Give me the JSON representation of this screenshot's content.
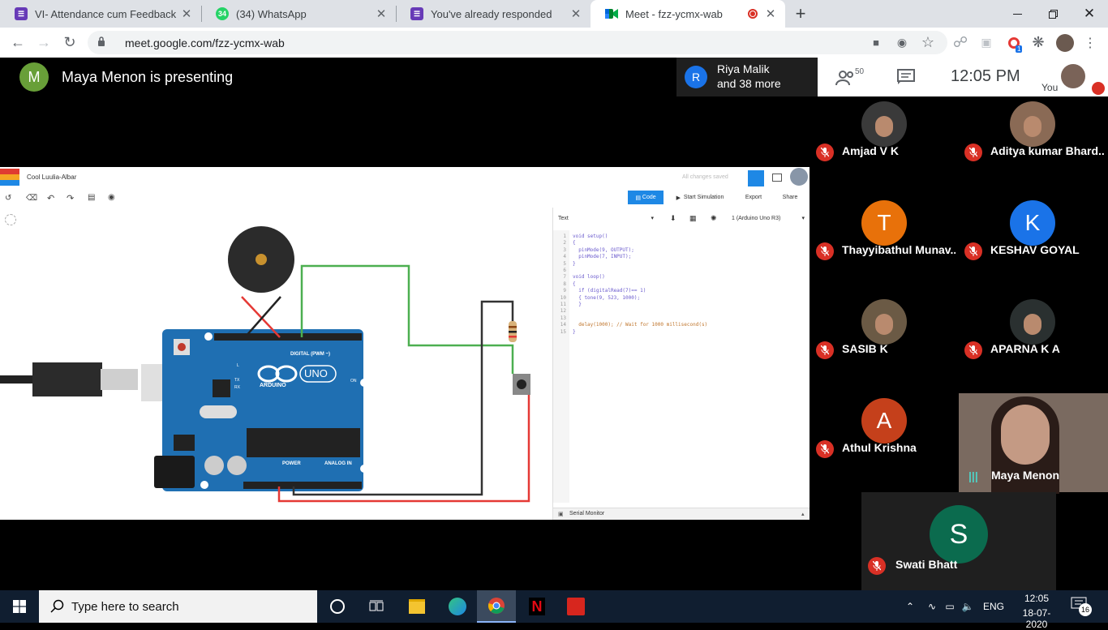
{
  "browser": {
    "tabs": [
      {
        "title": "VI- Attendance cum Feedback , S",
        "icon": "forms-icon",
        "color": "#673ab7",
        "active": false
      },
      {
        "title": "(34) WhatsApp",
        "icon": "whatsapp-icon",
        "badge": "34",
        "color": "#25d366",
        "active": false
      },
      {
        "title": "You've already responded",
        "icon": "forms-icon",
        "color": "#673ab7",
        "active": false
      },
      {
        "title": "Meet - fzz-ycmx-wab",
        "icon": "meet-icon",
        "color": "#00897b",
        "active": true
      }
    ],
    "new_tab": "+",
    "url": "meet.google.com/fzz-ycmx-wab",
    "extension_badge": "1"
  },
  "meet": {
    "presenter_initial": "M",
    "presenter_text": "Maya Menon is presenting",
    "pin_initial": "R",
    "pin_line1": "Riya Malik",
    "pin_line2": "and 38 more",
    "people_count": "50",
    "time": "12:05 PM",
    "you_label": "You",
    "participants": [
      {
        "name": "Amjad V K",
        "type": "photo",
        "color": "#3a3a3a"
      },
      {
        "name": "Aditya kumar Bhard...",
        "type": "photo",
        "color": "#8a6a55"
      },
      {
        "name": "Thayyibathul Munav...",
        "type": "letter",
        "initial": "T",
        "color": "#e8710a"
      },
      {
        "name": "KESHAV GOYAL",
        "type": "letter",
        "initial": "K",
        "color": "#1a73e8"
      },
      {
        "name": "SASIB K",
        "type": "photo",
        "color": "#6b5a45"
      },
      {
        "name": "APARNA K A",
        "type": "photo",
        "color": "#2a3030"
      },
      {
        "name": "Athul Krishna",
        "type": "letter",
        "initial": "A",
        "color": "#c5401b"
      },
      {
        "name": "Maya Menon",
        "type": "video",
        "color": "#7a6a60"
      },
      {
        "name": "Swati Bhatt",
        "type": "letter",
        "initial": "S",
        "color": "#0b6b4e"
      }
    ]
  },
  "tinkercad": {
    "logo": [
      "TIN",
      "KER",
      "CAD"
    ],
    "project": "Cool Luulia-Albar",
    "saved": "All changes saved",
    "code_button": "Code",
    "start_sim": "Start Simulation",
    "export": "Export",
    "share": "Share",
    "code_mode": "Text",
    "board": "1 (Arduino Uno R3)",
    "serial_monitor": "Serial Monitor",
    "code_lines": [
      {
        "n": "1",
        "t": "void setup()"
      },
      {
        "n": "2",
        "t": "{"
      },
      {
        "n": "3",
        "t": "  pinMode(9, OUTPUT);"
      },
      {
        "n": "4",
        "t": "  pinMode(7, INPUT);"
      },
      {
        "n": "5",
        "t": "}"
      },
      {
        "n": "6",
        "t": ""
      },
      {
        "n": "7",
        "t": "void loop()"
      },
      {
        "n": "8",
        "t": "{"
      },
      {
        "n": "9",
        "t": "  if (digitalRead(7)== 1)"
      },
      {
        "n": "10",
        "t": "  { tone(9, 523, 1000);"
      },
      {
        "n": "11",
        "t": "  }"
      },
      {
        "n": "12",
        "t": ""
      },
      {
        "n": "13",
        "t": ""
      },
      {
        "n": "14",
        "t": "  delay(1000); // Wait for 1000 millisecond(s)"
      },
      {
        "n": "15",
        "t": "}"
      }
    ],
    "board_labels": {
      "digital": "DIGITAL (PWM ~)",
      "arduino": "ARDUINO",
      "uno": "UNO",
      "power": "POWER",
      "analog": "ANALOG IN",
      "on": "ON",
      "l": "L",
      "tx": "TX",
      "rx": "RX"
    }
  },
  "taskbar": {
    "search_placeholder": "Type here to search",
    "lang": "ENG",
    "time": "12:05",
    "date": "18-07-2020",
    "notif_count": "16"
  }
}
